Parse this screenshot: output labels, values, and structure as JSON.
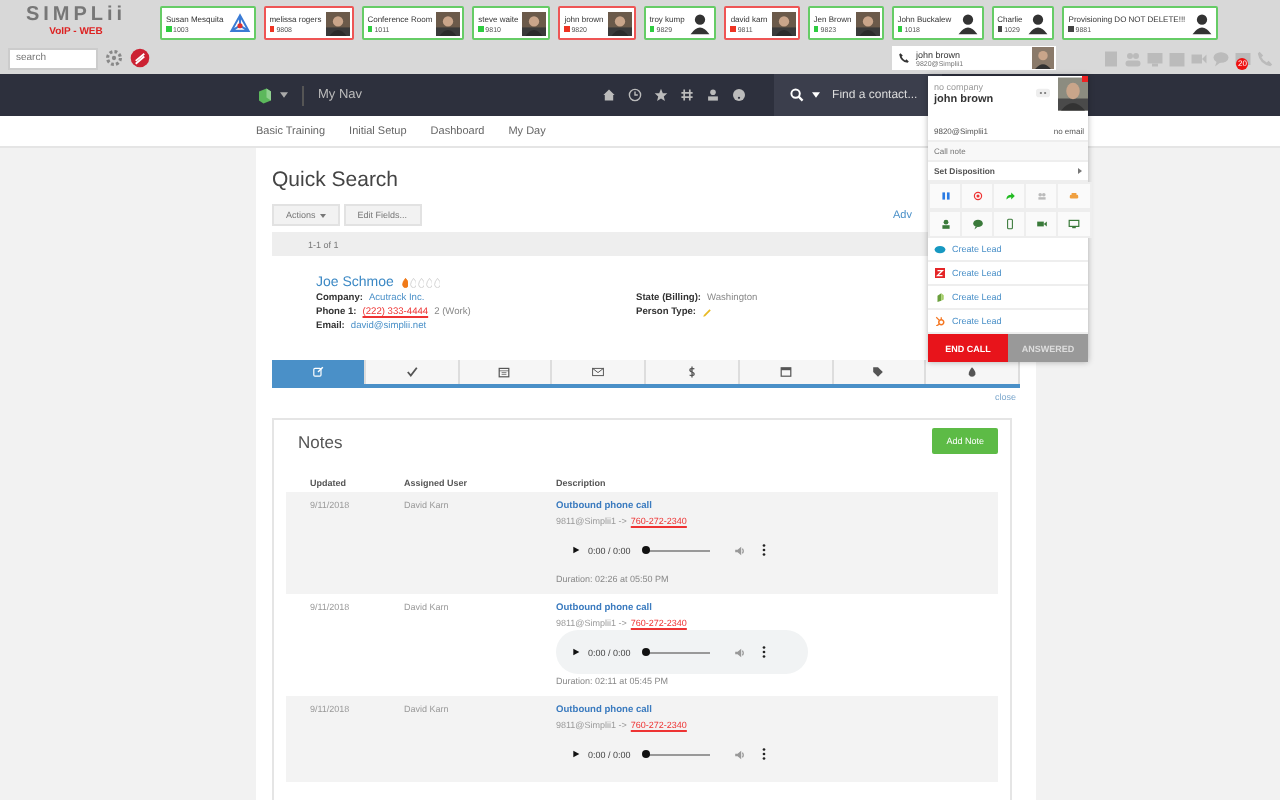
{
  "header": {
    "logo": "SIMPLii",
    "tagline": "VoIP - WEB",
    "search": {
      "placeholder": "search"
    }
  },
  "contacts": [
    {
      "name": "Susan Mesquita",
      "ext": "1003",
      "color": "#2ecc40",
      "busy": false,
      "kind": "network"
    },
    {
      "name": "melissa rogers",
      "ext": "9808",
      "color": "#ee3322",
      "busy": true
    },
    {
      "name": "Conference Room",
      "ext": "1011",
      "color": "#2ecc40",
      "busy": false
    },
    {
      "name": "steve waite",
      "ext": "9810",
      "color": "#2ecc40",
      "busy": false
    },
    {
      "name": "john brown",
      "ext": "9820",
      "color": "#ee3322",
      "busy": true
    },
    {
      "name": "troy kump",
      "ext": "9829",
      "color": "#2ecc40",
      "busy": false,
      "kind": "person"
    },
    {
      "name": "david karn",
      "ext": "9811",
      "color": "#ee3322",
      "busy": true
    },
    {
      "name": "Jen Brown",
      "ext": "9823",
      "color": "#2ecc40",
      "busy": false
    },
    {
      "name": "John Buckalew",
      "ext": "1018",
      "color": "#2ecc40",
      "busy": false,
      "kind": "person"
    },
    {
      "name": "Charlie",
      "ext": "1029",
      "color": "#444444",
      "busy": false,
      "kind": "person"
    },
    {
      "name": "Provisioning DO NOT DELETE!!!",
      "ext": "9881",
      "color": "#444444",
      "busy": false,
      "kind": "person"
    }
  ],
  "active_call": {
    "name": "john brown",
    "address": "9820@Simplii1"
  },
  "notification_badge": "20",
  "nav": {
    "title": "My Nav",
    "search": {
      "placeholder": "Find a contact..."
    }
  },
  "menu": [
    "Basic Training",
    "Initial Setup",
    "Dashboard",
    "My Day"
  ],
  "quick_search": {
    "title": "Quick Search",
    "buttons": [
      {
        "label": "Actions",
        "kind": "dropdown"
      },
      {
        "label": "Edit Fields...",
        "kind": "plain"
      }
    ],
    "advanced_link": "Adv",
    "count": "1-1 of 1"
  },
  "contact": {
    "name": "Joe Schmoe",
    "stars": 1,
    "fields_left": [
      {
        "label": "Company:",
        "value": "Acutrack Inc.",
        "kind": "link"
      },
      {
        "label": "Phone 1:",
        "value": "(222) 333-4444",
        "extra": "2 (Work)",
        "kind": "phone"
      },
      {
        "label": "Email:",
        "value": "david@simplii.net",
        "kind": "link"
      }
    ],
    "fields_right": [
      {
        "label": "State (Billing):",
        "value": "Washington",
        "kind": "text"
      },
      {
        "label": "Person Type:",
        "kind": "edit"
      }
    ]
  },
  "tabs": [
    {
      "kind": "note",
      "selected": true
    },
    {
      "kind": "check",
      "selected": false
    },
    {
      "kind": "calendar",
      "selected": false
    },
    {
      "kind": "mail",
      "selected": false
    },
    {
      "kind": "dollar",
      "selected": false
    },
    {
      "kind": "window",
      "selected": false
    },
    {
      "kind": "tag",
      "selected": false
    },
    {
      "kind": "flame",
      "selected": false
    }
  ],
  "close_link": "close",
  "notes": {
    "title": "Notes",
    "add_button": "Add Note",
    "columns": [
      "Updated",
      "Assigned User",
      "Description"
    ],
    "rows": [
      {
        "updated": "9/11/2018",
        "user": "David Karn",
        "title": "Outbound phone call",
        "from": "9811@Simplii1 ->",
        "number": "760-272-2340",
        "time": "0:00 / 0:00",
        "duration": "Duration: 02:26 at 05:50 PM"
      },
      {
        "updated": "9/11/2018",
        "user": "David Karn",
        "title": "Outbound phone call",
        "from": "9811@Simplii1 ->",
        "number": "760-272-2340",
        "time": "0:00 / 0:00",
        "duration": "Duration: 02:11 at 05:45 PM"
      },
      {
        "updated": "9/11/2018",
        "user": "David Karn",
        "title": "Outbound phone call",
        "from": "9811@Simplii1 ->",
        "number": "760-272-2340",
        "time": "0:00 / 0:00"
      }
    ]
  },
  "call_panel": {
    "company": "no company",
    "name": "john brown",
    "address": "9820@Simplii1",
    "email": "no email",
    "note": {
      "placeholder": "Call note"
    },
    "disposition": "Set Disposition",
    "leads": [
      {
        "kind": "salesforce",
        "label": "Create Lead"
      },
      {
        "kind": "zoho",
        "label": "Create Lead"
      },
      {
        "kind": "sugar",
        "label": "Create Lead"
      },
      {
        "kind": "hubspot",
        "label": "Create Lead"
      }
    ],
    "end_button": "END CALL",
    "status_button": "ANSWERED"
  }
}
